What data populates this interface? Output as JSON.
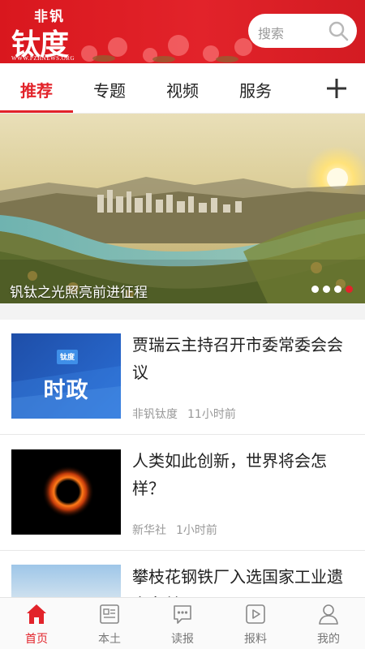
{
  "brand": {
    "small": "非钒",
    "big": "钛度",
    "url": "WWW.PZHNEWS.ORG",
    "accent": "#e2232a"
  },
  "search": {
    "placeholder": "搜索",
    "icon": "search-icon"
  },
  "tabs": [
    {
      "label": "推荐",
      "active": true
    },
    {
      "label": "专题",
      "active": false
    },
    {
      "label": "视频",
      "active": false
    },
    {
      "label": "服务",
      "active": false
    }
  ],
  "add_icon": "plus-icon",
  "banner": {
    "caption": "钒钛之光照亮前进征程",
    "slide_count": 4,
    "active_slide": 4
  },
  "news": [
    {
      "title": "贾瑞云主持召开市委常委会会议",
      "source": "非钒钛度",
      "time": "11小时前",
      "thumb_badge": "钛度",
      "thumb_text": "时政"
    },
    {
      "title": "人类如此创新，世界将会怎样？",
      "source": "新华社",
      "time": "1小时前"
    },
    {
      "title": "攀枝花钢铁厂入选国家工业遗产名单"
    }
  ],
  "bottom_nav": [
    {
      "label": "首页",
      "icon": "home-icon",
      "active": true
    },
    {
      "label": "本土",
      "icon": "local-icon",
      "active": false
    },
    {
      "label": "读报",
      "icon": "newspaper-icon",
      "active": false
    },
    {
      "label": "报料",
      "icon": "report-video-icon",
      "active": false
    },
    {
      "label": "我的",
      "icon": "profile-icon",
      "active": false
    }
  ]
}
